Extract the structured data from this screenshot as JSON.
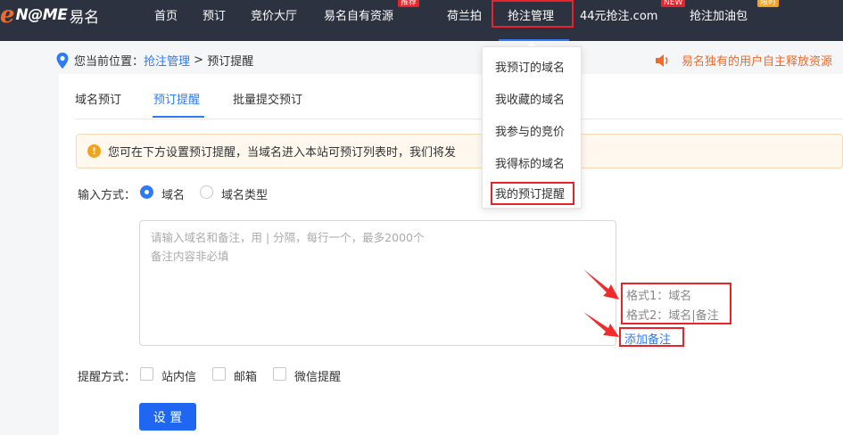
{
  "logo": {
    "e": "e",
    "brand": "N@ME",
    "cn": "易名"
  },
  "nav": {
    "items": [
      {
        "label": "首页"
      },
      {
        "label": "预订"
      },
      {
        "label": "竞价大厅"
      },
      {
        "label": "易名自有资源"
      },
      {
        "label": "荷兰拍"
      },
      {
        "label": "抢注管理"
      },
      {
        "label": "44元抢注.com"
      },
      {
        "label": "抢注加油包"
      }
    ],
    "badges": {
      "recommend": "推荐",
      "new": "NEW",
      "limited": "限时"
    }
  },
  "breadcrumb": {
    "prefix": "您当前位置：",
    "link": "抢注管理",
    "sep": " > ",
    "current": "预订提醒"
  },
  "announcement": "易名独有的用户自主释放资源",
  "tabs": [
    {
      "label": "域名预订"
    },
    {
      "label": "预订提醒"
    },
    {
      "label": "批量提交预订"
    }
  ],
  "notice": "您可在下方设置预订提醒，当域名进入本站可预订列表时，我们将发",
  "input_mode": {
    "label": "输入方式：",
    "options": [
      {
        "label": "域名",
        "checked": true
      },
      {
        "label": "域名类型",
        "checked": false
      }
    ]
  },
  "textarea": {
    "placeholder_line1": "请输入域名和备注，用 | 分隔，每行一个，最多2000个",
    "placeholder_line2": "备注内容非必填"
  },
  "format": {
    "line1": "格式1：域名",
    "line2": "格式2：域名|备注",
    "add_note": "添加备注"
  },
  "remind_mode": {
    "label": "提醒方式：",
    "options": [
      {
        "label": "站内信"
      },
      {
        "label": "邮箱"
      },
      {
        "label": "微信提醒"
      }
    ]
  },
  "set_button": "设 置",
  "dropdown": {
    "items": [
      {
        "label": "我预订的域名"
      },
      {
        "label": "我收藏的域名"
      },
      {
        "label": "我参与的竞价"
      },
      {
        "label": "我得标的域名"
      },
      {
        "label": "我的预订提醒"
      }
    ]
  },
  "colors": {
    "accent": "#2f7bf6",
    "highlight": "#e8242a",
    "nav_bg": "#2d3240",
    "orange": "#f06a2a"
  }
}
